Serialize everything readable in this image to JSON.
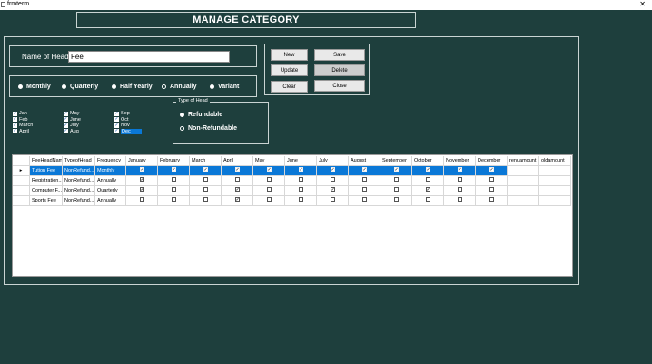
{
  "window": {
    "title": "frmterm",
    "close_glyph": "✕",
    "icon": "form-icon"
  },
  "header": {
    "title": "MANAGE CATEGORY"
  },
  "head_name": {
    "label": "Name of Head",
    "value": "Fee"
  },
  "frequency": {
    "options": [
      {
        "label": "Monthly",
        "selected": true
      },
      {
        "label": "Quarterly",
        "selected": true
      },
      {
        "label": "Half Yearly",
        "selected": true
      },
      {
        "label": "Annually",
        "selected": false
      },
      {
        "label": "Variant",
        "selected": true
      }
    ]
  },
  "months": [
    {
      "label": "Jan",
      "checked": true
    },
    {
      "label": "Feb",
      "checked": true
    },
    {
      "label": "March",
      "checked": true
    },
    {
      "label": "April",
      "checked": true
    },
    {
      "label": "May",
      "checked": true
    },
    {
      "label": "June",
      "checked": true
    },
    {
      "label": "July",
      "checked": true
    },
    {
      "label": "Aug",
      "checked": true
    },
    {
      "label": "Sep",
      "checked": true
    },
    {
      "label": "Oct",
      "checked": true
    },
    {
      "label": "Nov",
      "checked": true
    },
    {
      "label": "Dec",
      "checked": true,
      "selected": true
    }
  ],
  "buttons": {
    "new": "New",
    "save": "Save",
    "update": "Update",
    "delete": "Delete",
    "clear": "Clear",
    "close": "Close"
  },
  "type_of_head": {
    "legend": "Type of Head",
    "options": [
      {
        "label": "Refundable",
        "selected": true
      },
      {
        "label": "Non-Refundable",
        "selected": false
      }
    ]
  },
  "grid": {
    "columns": [
      "FeeHeadName",
      "TypeofHead",
      "Frequency",
      "January",
      "February",
      "March",
      "April",
      "May",
      "June",
      "July",
      "August",
      "September",
      "October",
      "November",
      "December",
      "renuamount",
      "oldamount"
    ],
    "rows": [
      {
        "name": "Tution Fee",
        "type": "NonRefund...",
        "frequency": "Monthly",
        "months": [
          true,
          true,
          true,
          true,
          true,
          true,
          true,
          true,
          true,
          true,
          true,
          true
        ],
        "selected": true
      },
      {
        "name": "Registration...",
        "type": "NonRefund...",
        "frequency": "Annually",
        "months": [
          true,
          false,
          false,
          false,
          false,
          false,
          false,
          false,
          false,
          false,
          false,
          false
        ],
        "selected": false
      },
      {
        "name": "Computer F...",
        "type": "NonRefund...",
        "frequency": "Quarterly",
        "months": [
          true,
          false,
          false,
          true,
          false,
          false,
          true,
          false,
          false,
          true,
          false,
          false
        ],
        "selected": false
      },
      {
        "name": "Sports Fee",
        "type": "NonRefund...",
        "frequency": "Annually",
        "months": [
          false,
          false,
          false,
          true,
          false,
          false,
          false,
          false,
          false,
          false,
          false,
          false
        ],
        "selected": false
      }
    ]
  }
}
